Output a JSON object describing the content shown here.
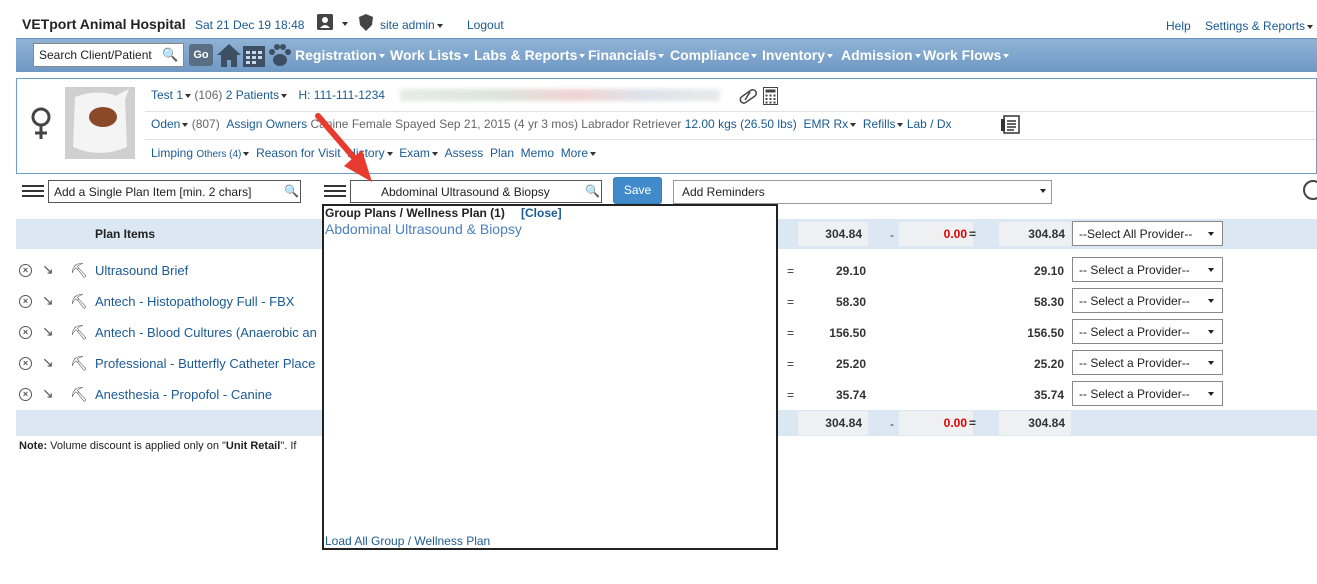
{
  "header": {
    "brand": "VETport Animal Hospital",
    "datetime": "Sat 21 Dec 19 18:48",
    "user": "site admin",
    "logout": "Logout",
    "help": "Help",
    "settings": "Settings & Reports"
  },
  "nav": {
    "search_placeholder": "Search Client/Patient",
    "go": "Go",
    "items": [
      "Registration",
      "Work Lists",
      "Labs & Reports",
      "Financials",
      "Compliance",
      "Inventory",
      "Admission",
      "Work Flows"
    ]
  },
  "patient": {
    "client_name": "Test 1",
    "client_id": "(106)",
    "patients_count": "2",
    "patients_label": "Patients",
    "phone": "H: 111-111-1234",
    "pet_name": "Oden",
    "pet_id": "(807)",
    "assign_owners": "Assign Owners",
    "species": "Canine",
    "sex": "Female Spayed",
    "dob": "Sep 21, 2015 (4 yr 3 mos)",
    "breed": "Labrador Retriever",
    "weight": "12.00 kgs (26.50 lbs)",
    "emr": "EMR",
    "rx": "Rx",
    "refills": "Refills",
    "lab_dx": "Lab / Dx",
    "complaint": "Limping",
    "others": "Others (4)",
    "reason": "Reason for Visit",
    "history": "History",
    "exam": "Exam",
    "assess": "Assess",
    "plan": "Plan",
    "memo": "Memo",
    "more": "More"
  },
  "plan": {
    "single_item_placeholder": "Add a Single Plan Item [min. 2 chars]",
    "group_input_value": "Abdominal Ultrasound & Biopsy",
    "save": "Save",
    "reminders": "Add Reminders",
    "header_label": "Plan Items",
    "header_total": "304.84",
    "header_discount": "0.00",
    "header_net": "304.84",
    "header_provider": "--Select All Provider--",
    "items": [
      {
        "name": "Ultrasound Brief",
        "price": "29.10",
        "net": "29.10",
        "provider": "-- Select a Provider--"
      },
      {
        "name": "Antech - Histopathology Full - FBX",
        "price": "58.30",
        "net": "58.30",
        "provider": "-- Select a Provider--"
      },
      {
        "name": "Antech - Blood Cultures (Anaerobic an",
        "price": "156.50",
        "net": "156.50",
        "provider": "-- Select a Provider--"
      },
      {
        "name": "Professional - Butterfly Catheter Place",
        "price": "25.20",
        "net": "25.20",
        "provider": "-- Select a Provider--"
      },
      {
        "name": "Anesthesia - Propofol - Canine",
        "price": "35.74",
        "net": "35.74",
        "provider": "-- Select a Provider--"
      }
    ],
    "footer_total": "304.84",
    "footer_discount": "0.00",
    "footer_net": "304.84",
    "note_bold": "Note:",
    "note_text": " Volume discount is applied only on \"",
    "note_unit_retail": "Unit Retail",
    "note_tail": "\". If"
  },
  "popup": {
    "title": "Group Plans / Wellness Plan (1)",
    "close": "[Close]",
    "option": "Abdominal Ultrasound & Biopsy",
    "load_all": "Load All Group / Wellness Plan"
  },
  "colors": {
    "nav_bg": "#7fa6cd",
    "link": "#1b5a93",
    "save_bg": "#428bca",
    "discount_red": "#e00000",
    "arrow_red": "#e63b2e"
  }
}
